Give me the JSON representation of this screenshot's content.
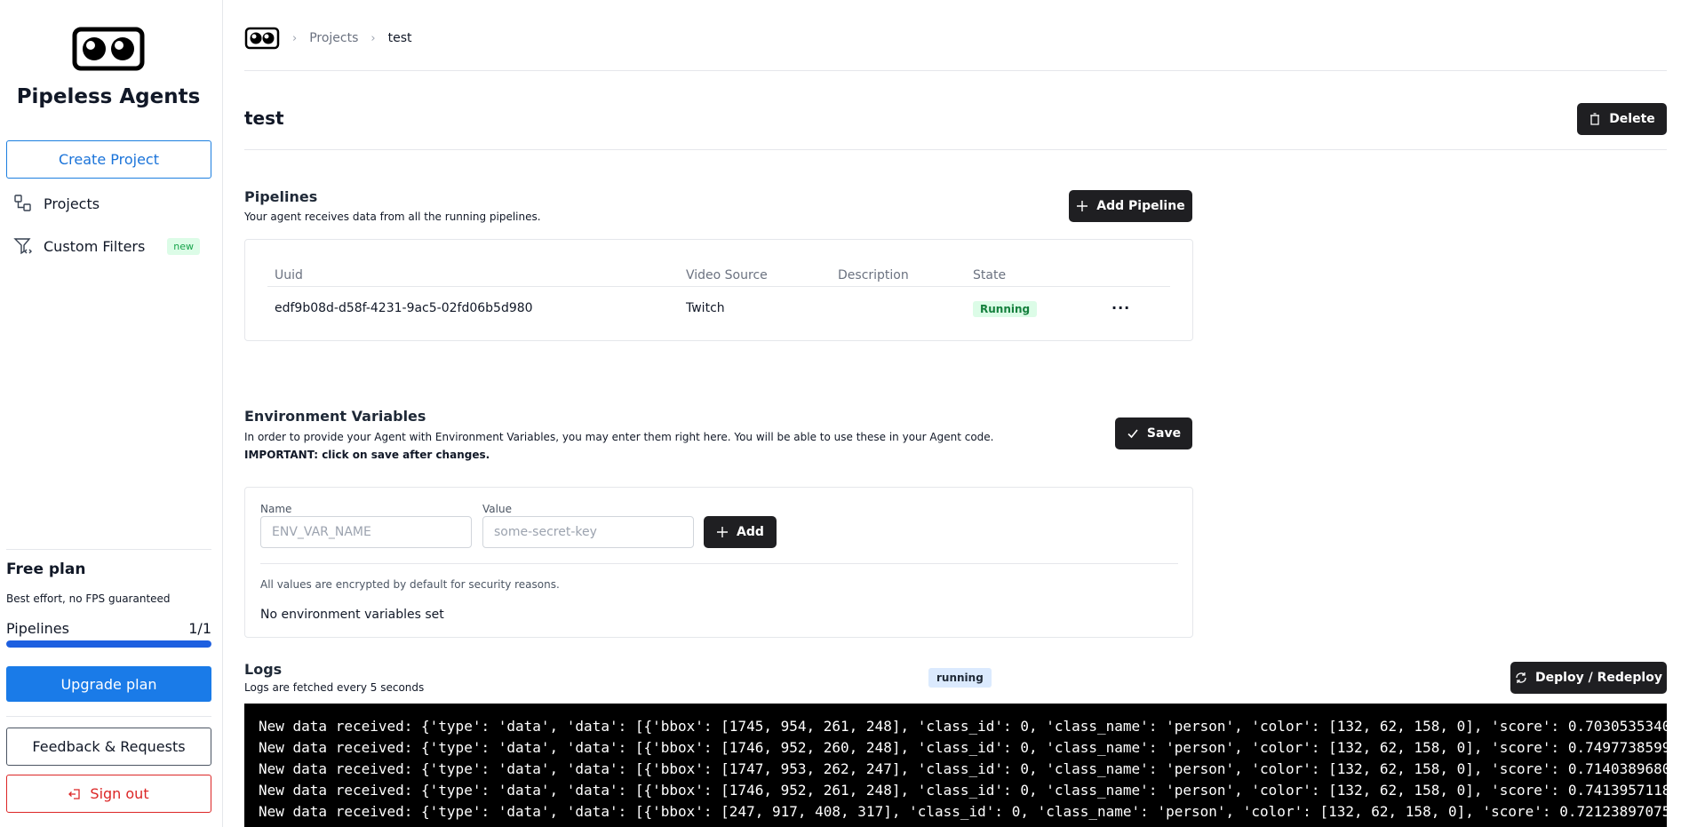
{
  "sidebar": {
    "app_name": "Pipeless Agents",
    "create_project_label": "Create Project",
    "nav": {
      "projects_label": "Projects",
      "custom_filters_label": "Custom Filters",
      "custom_filters_badge": "new"
    },
    "plan": {
      "title": "Free plan",
      "description": "Best effort, no FPS guaranteed",
      "pipelines_label": "Pipelines",
      "pipelines_usage": "1/1",
      "usage_fraction": 1.0
    },
    "upgrade_label": "Upgrade plan",
    "feedback_label": "Feedback & Requests",
    "signout_label": "Sign out"
  },
  "breadcrumb": {
    "items": [
      "Projects",
      "test"
    ]
  },
  "project": {
    "title": "test",
    "delete_label": "Delete"
  },
  "pipelines": {
    "title": "Pipelines",
    "description": "Your agent receives data from all the running pipelines.",
    "add_label": "Add Pipeline",
    "columns": [
      "Uuid",
      "Video Source",
      "Description",
      "State"
    ],
    "rows": [
      {
        "uuid": "edf9b08d-d58f-4231-9ac5-02fd06b5d980",
        "video_source": "Twitch",
        "description": "",
        "state": "Running"
      }
    ],
    "more_icon": "ellipsis-icon"
  },
  "env": {
    "title": "Environment Variables",
    "description": "In order to provide your Agent with Environment Variables, you may enter them right here. You will be able to use these in your Agent code.",
    "important": "IMPORTANT: click on save after changes.",
    "save_label": "Save",
    "name_label": "Name",
    "name_placeholder": "ENV_VAR_NAME",
    "value_label": "Value",
    "value_placeholder": "some-secret-key",
    "add_label": "Add",
    "note": "All values are encrypted by default for security reasons.",
    "empty": "No environment variables set"
  },
  "logs": {
    "title": "Logs",
    "description": "Logs are fetched every 5 seconds",
    "status": "running",
    "deploy_label": "Deploy / Redeploy",
    "lines": [
      "New data received: {'type': 'data', 'data': [{'bbox': [1745, 954, 261, 248], 'class_id': 0, 'class_name': 'person', 'color': [132, 62, 158, 0], 'score': 0.7030535340",
      "New data received: {'type': 'data', 'data': [{'bbox': [1746, 952, 260, 248], 'class_id': 0, 'class_name': 'person', 'color': [132, 62, 158, 0], 'score': 0.7497738599",
      "New data received: {'type': 'data', 'data': [{'bbox': [1747, 953, 262, 247], 'class_id': 0, 'class_name': 'person', 'color': [132, 62, 158, 0], 'score': 0.7140389680",
      "New data received: {'type': 'data', 'data': [{'bbox': [1746, 952, 261, 248], 'class_id': 0, 'class_name': 'person', 'color': [132, 62, 158, 0], 'score': 0.7413957118",
      "New data received: {'type': 'data', 'data': [{'bbox': [247, 917, 408, 317], 'class_id': 0, 'class_name': 'person', 'color': [132, 62, 158, 0], 'score': 0.72123897075"
    ]
  },
  "colors": {
    "primary_blue": "#1a7be8",
    "dark_button": "#1f1f22",
    "danger": "#dc2626",
    "success_bg": "#dcfce7",
    "success_text": "#15803d"
  }
}
